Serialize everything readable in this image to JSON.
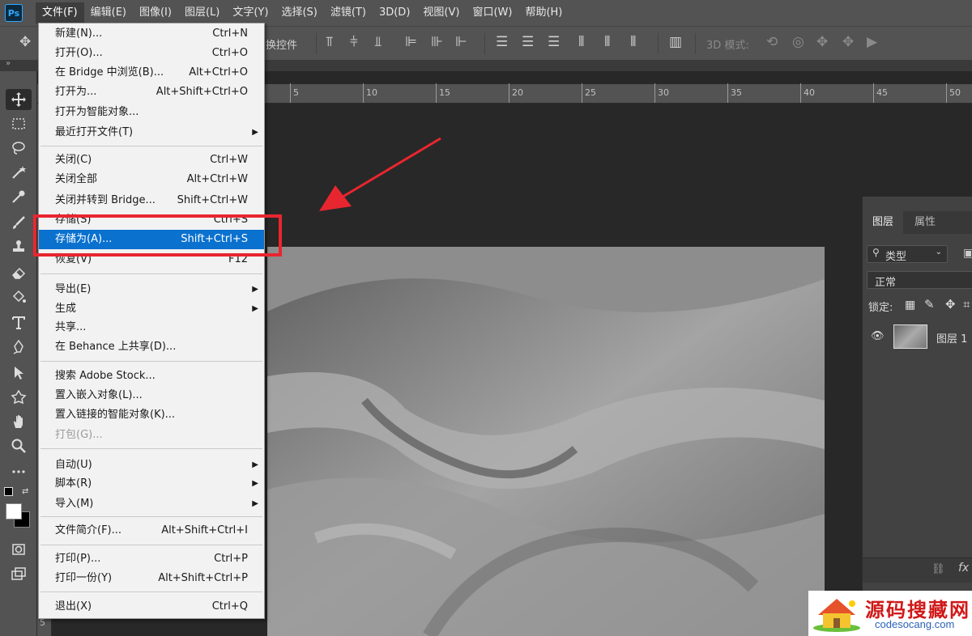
{
  "app": {
    "logo": "Ps"
  },
  "menubar": {
    "items": [
      "文件(F)",
      "编辑(E)",
      "图像(I)",
      "图层(L)",
      "文字(Y)",
      "选择(S)",
      "滤镜(T)",
      "3D(D)",
      "视图(V)",
      "窗口(W)",
      "帮助(H)"
    ]
  },
  "options_bar": {
    "transform_controls_label": "换控件",
    "mode_3d_label": "3D 模式:"
  },
  "file_menu": {
    "items": [
      {
        "label": "新建(N)...",
        "shortcut": "Ctrl+N"
      },
      {
        "label": "打开(O)...",
        "shortcut": "Ctrl+O"
      },
      {
        "label": "在 Bridge 中浏览(B)...",
        "shortcut": "Alt+Ctrl+O"
      },
      {
        "label": "打开为...",
        "shortcut": "Alt+Shift+Ctrl+O"
      },
      {
        "label": "打开为智能对象...",
        "shortcut": ""
      },
      {
        "label": "最近打开文件(T)",
        "shortcut": "",
        "submenu": true
      },
      {
        "label": "关闭(C)",
        "shortcut": "Ctrl+W"
      },
      {
        "label": "关闭全部",
        "shortcut": "Alt+Ctrl+W"
      },
      {
        "label": "关闭并转到 Bridge...",
        "shortcut": "Shift+Ctrl+W"
      },
      {
        "label": "存储(S)",
        "shortcut": "Ctrl+S"
      },
      {
        "label": "存储为(A)...",
        "shortcut": "Shift+Ctrl+S",
        "highlighted": true
      },
      {
        "label": "恢复(V)",
        "shortcut": "F12"
      },
      {
        "label": "导出(E)",
        "shortcut": "",
        "submenu": true
      },
      {
        "label": "生成",
        "shortcut": "",
        "submenu": true
      },
      {
        "label": "共享...",
        "shortcut": ""
      },
      {
        "label": "在 Behance 上共享(D)...",
        "shortcut": ""
      },
      {
        "label": "搜索 Adobe Stock...",
        "shortcut": ""
      },
      {
        "label": "置入嵌入对象(L)...",
        "shortcut": ""
      },
      {
        "label": "置入链接的智能对象(K)...",
        "shortcut": ""
      },
      {
        "label": "打包(G)...",
        "shortcut": "",
        "disabled": true
      },
      {
        "label": "自动(U)",
        "shortcut": "",
        "submenu": true
      },
      {
        "label": "脚本(R)",
        "shortcut": "",
        "submenu": true
      },
      {
        "label": "导入(M)",
        "shortcut": "",
        "submenu": true
      },
      {
        "label": "文件简介(F)...",
        "shortcut": "Alt+Shift+Ctrl+I"
      },
      {
        "label": "打印(P)...",
        "shortcut": "Ctrl+P"
      },
      {
        "label": "打印一份(Y)",
        "shortcut": "Alt+Shift+Ctrl+P"
      },
      {
        "label": "退出(X)",
        "shortcut": "Ctrl+Q"
      }
    ]
  },
  "ruler": {
    "h_labels": [
      "5",
      "10",
      "15",
      "20",
      "25",
      "30",
      "35",
      "40",
      "45",
      "50"
    ],
    "v_labels": [
      "5"
    ]
  },
  "layers_panel": {
    "tabs": [
      "图层",
      "属性"
    ],
    "filter_label": "类型",
    "blend_mode": "正常",
    "lock_label": "锁定:",
    "layer_name": "图层 1",
    "fx_label": "fx"
  },
  "watermark": {
    "title": "源码搜藏网",
    "url": "codesocang.com"
  },
  "colors": {
    "highlight": "#0a71cf",
    "annotation": "#e8262f",
    "panel_bg": "#535353"
  }
}
